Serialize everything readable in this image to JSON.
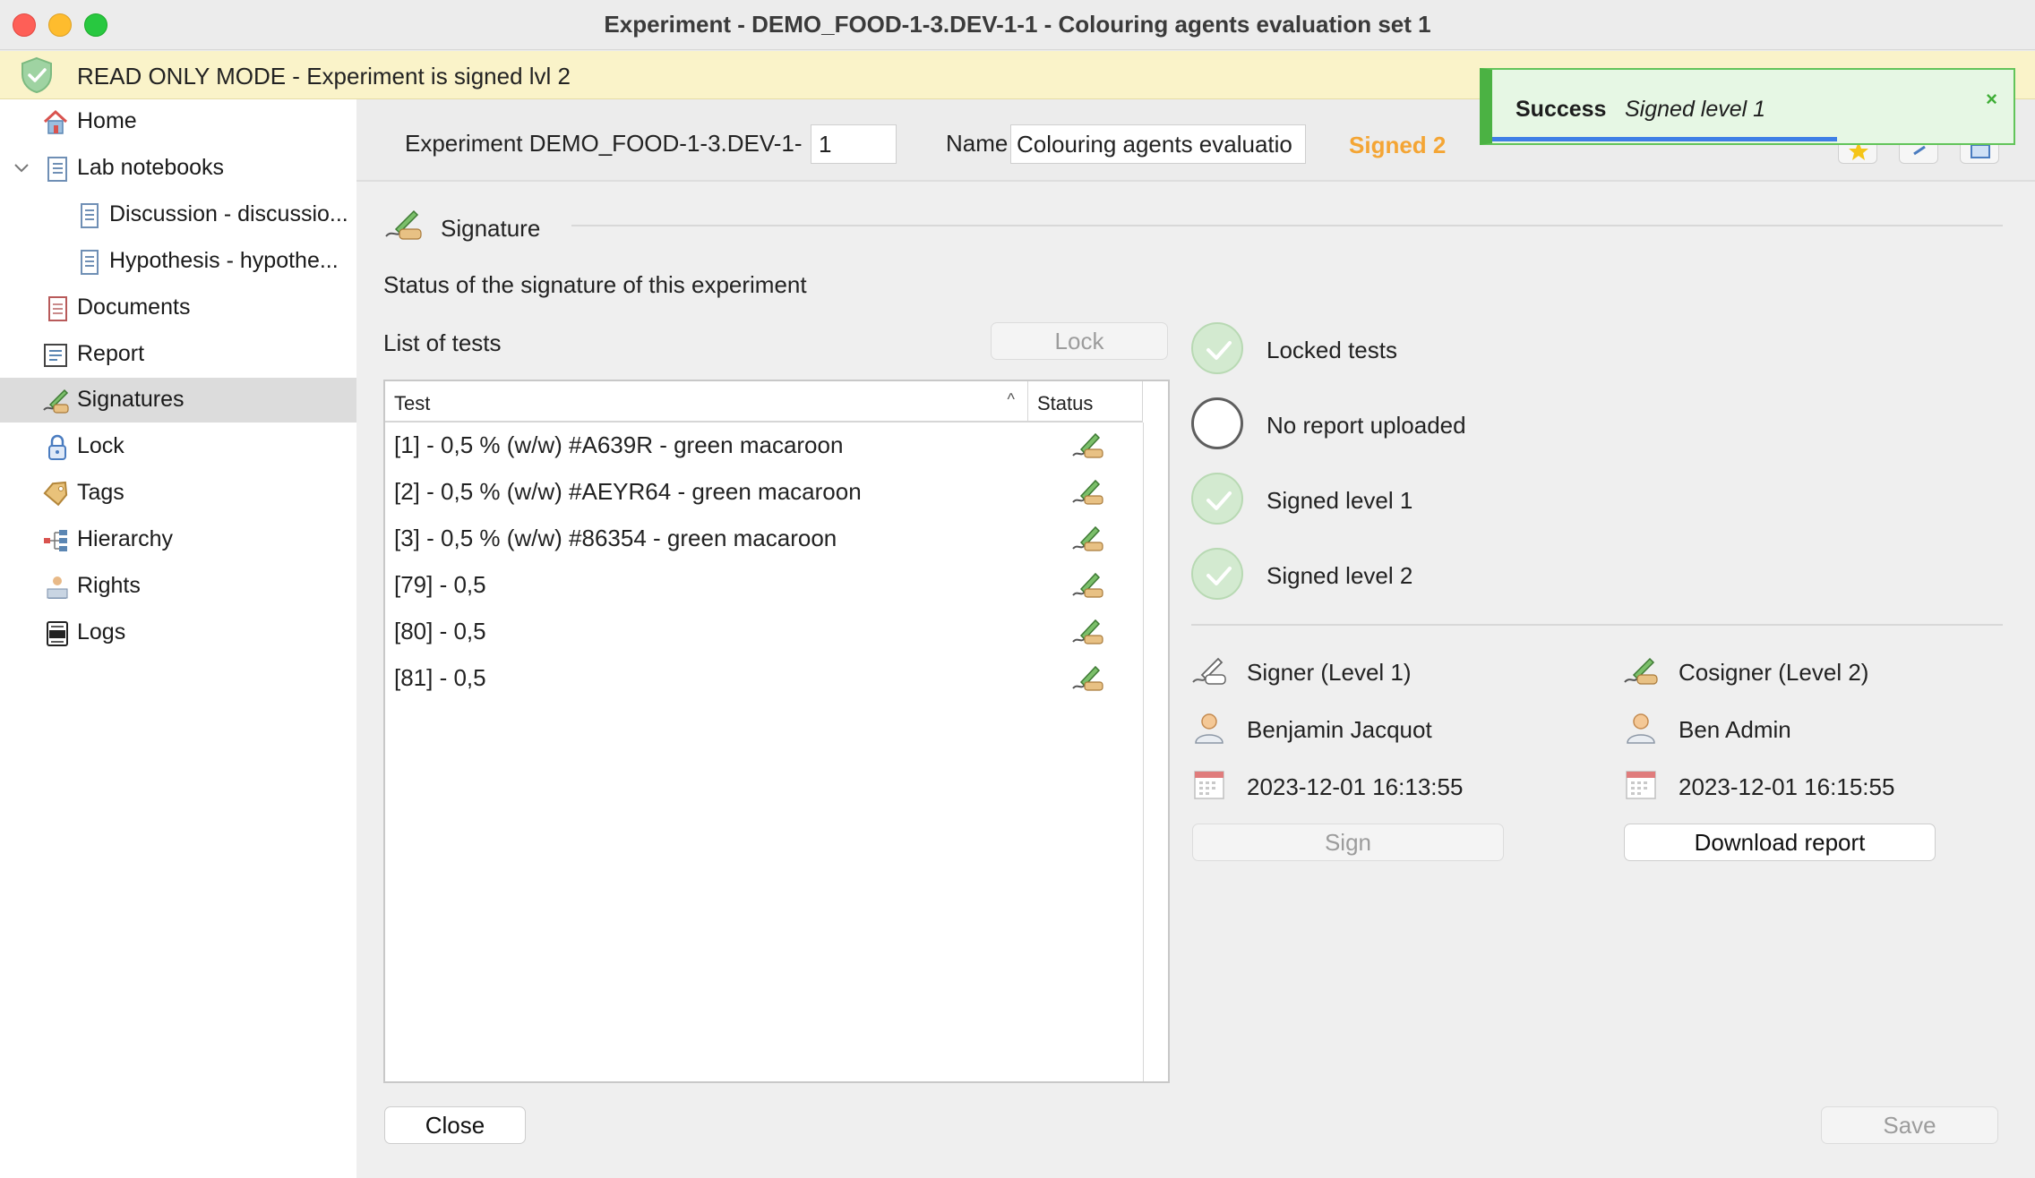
{
  "window": {
    "title": "Experiment - DEMO_FOOD-1-3.DEV-1-1 - Colouring agents evaluation set 1"
  },
  "banner": {
    "text": "READ ONLY MODE - Experiment is signed lvl 2"
  },
  "sidebar": {
    "items": [
      {
        "label": "Home",
        "icon": "home-icon"
      },
      {
        "label": "Lab notebooks",
        "icon": "notebook-icon"
      },
      {
        "label": "Discussion - discussio...",
        "icon": "notebook-page-icon"
      },
      {
        "label": "Hypothesis - hypothe...",
        "icon": "notebook-page-icon"
      },
      {
        "label": "Documents",
        "icon": "documents-icon"
      },
      {
        "label": "Report",
        "icon": "report-icon"
      },
      {
        "label": "Signatures",
        "icon": "signature-icon"
      },
      {
        "label": "Lock",
        "icon": "lock-icon"
      },
      {
        "label": "Tags",
        "icon": "tag-icon"
      },
      {
        "label": "Hierarchy",
        "icon": "hierarchy-icon"
      },
      {
        "label": "Rights",
        "icon": "rights-icon"
      },
      {
        "label": "Logs",
        "icon": "logs-icon"
      }
    ],
    "active": "Signatures"
  },
  "header": {
    "experiment_label": "Experiment DEMO_FOOD-1-3.DEV-1-",
    "experiment_value": "1",
    "name_label": "Name",
    "name_value": "Colouring agents evaluatio",
    "signed_badge": "Signed 2"
  },
  "toast": {
    "title": "Success",
    "message": "Signed level 1",
    "close": "×",
    "progress": 0.66
  },
  "signature": {
    "section_title": "Signature",
    "status_desc": "Status of the signature of this experiment",
    "list_label": "List of tests",
    "lock_button": "Lock",
    "table": {
      "col_test": "Test",
      "col_status": "Status",
      "sort_caret": "^",
      "rows": [
        {
          "test": "[1] - 0,5 % (w/w) #A639R - green macaroon",
          "status_icon": "signed-icon"
        },
        {
          "test": "[2] - 0,5 % (w/w) #AEYR64 - green macaroon",
          "status_icon": "signed-icon"
        },
        {
          "test": "[3] - 0,5 % (w/w) #86354 - green macaroon",
          "status_icon": "signed-icon"
        },
        {
          "test": "[79] - 0,5",
          "status_icon": "signed-icon"
        },
        {
          "test": "[80] - 0,5",
          "status_icon": "signed-icon"
        },
        {
          "test": "[81] - 0,5",
          "status_icon": "signed-icon"
        }
      ]
    },
    "statuses": [
      {
        "label": "Locked tests",
        "done": true
      },
      {
        "label": "No report uploaded",
        "done": false
      },
      {
        "label": "Signed level 1",
        "done": true
      },
      {
        "label": "Signed level 2",
        "done": true
      }
    ],
    "signer": {
      "role": "Signer (Level 1)",
      "name": "Benjamin Jacquot",
      "date": "2023-12-01 16:13:55",
      "button": "Sign"
    },
    "cosigner": {
      "role": "Cosigner (Level 2)",
      "name": "Ben Admin",
      "date": "2023-12-01 16:15:55",
      "button": "Download report"
    }
  },
  "footer": {
    "close_button": "Close",
    "save_button": "Save"
  },
  "colors": {
    "accent_signed": "#f4a534",
    "success_green": "#4bb243",
    "banner_yellow": "#faf3c9"
  }
}
